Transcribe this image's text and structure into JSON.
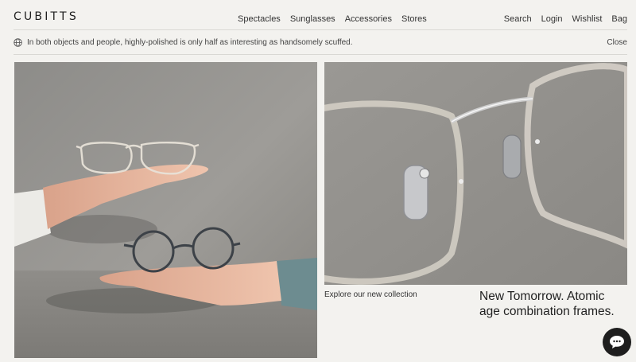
{
  "brand": {
    "logo_text": "CUBITTS"
  },
  "nav": {
    "main": [
      "Spectacles",
      "Sunglasses",
      "Accessories",
      "Stores"
    ],
    "user": [
      "Search",
      "Login",
      "Wishlist",
      "Bag"
    ]
  },
  "announcement": {
    "icon": "globe-icon",
    "text": "In both objects and people, highly-polished is only half as interesting as handsomely scuffed.",
    "close_label": "Close"
  },
  "hero": {
    "left_image": "hands-holding-glasses-photo",
    "right_image": "clear-frame-closeup-photo",
    "caption": "Explore our new collection",
    "headline": "New Tomorrow. Atomic age combination frames."
  },
  "chat": {
    "icon": "chat-bubble-icon"
  },
  "colors": {
    "background": "#f3f2ef",
    "text": "#2a2a2a",
    "chat_button": "#1e1e1e"
  }
}
